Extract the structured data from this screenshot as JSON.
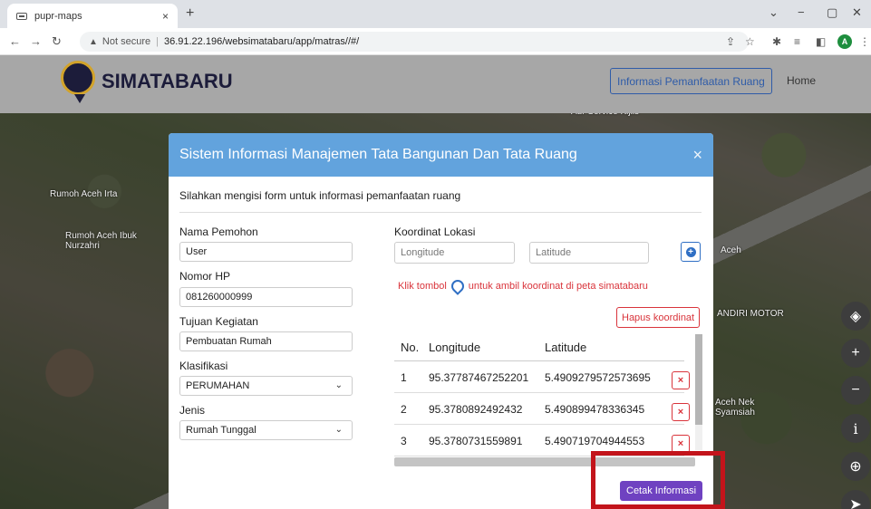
{
  "browser": {
    "tab_title": "pupr-maps",
    "tab_close": "×",
    "new_tab": "+",
    "security_text": "Not secure",
    "url": "36.91.22.196/websimatabaru/app/matras//#/",
    "profile_initial": "A"
  },
  "navbar": {
    "brand": "SIMATABARU",
    "info_button": "Informasi Pemanfaatan Ruang",
    "home_link": "Home"
  },
  "map_labels": [
    "Rumoh Aceh Irta",
    "Rumoh Aceh Ibuk Nurzahri",
    "Aceh",
    "ANDIRI MOTOR",
    "Aceh Nek Syamsiah",
    "Aur Service Kijils"
  ],
  "map_controls": [
    {
      "name": "layers-icon",
      "glyph": "◈"
    },
    {
      "name": "zoom-in-icon",
      "glyph": "+"
    },
    {
      "name": "zoom-out-icon",
      "glyph": "−"
    },
    {
      "name": "info-icon",
      "glyph": "i"
    },
    {
      "name": "globe-icon",
      "glyph": "⊕"
    }
  ],
  "modal": {
    "title": "Sistem Informasi Manajemen Tata Bangunan Dan Tata Ruang",
    "close": "×",
    "intro": "Silahkan mengisi form untuk informasi pemanfaatan ruang",
    "fields": {
      "nama_label": "Nama Pemohon",
      "nama_value": "User",
      "hp_label": "Nomor HP",
      "hp_value": "081260000999",
      "tujuan_label": "Tujuan Kegiatan",
      "tujuan_value": "Pembuatan Rumah",
      "klasifikasi_label": "Klasifikasi",
      "klasifikasi_value": "PERUMAHAN",
      "jenis_label": "Jenis",
      "jenis_value": "Rumah Tunggal"
    },
    "koordinat": {
      "label": "Koordinat Lokasi",
      "longitude_placeholder": "Longitude",
      "latitude_placeholder": "Latitude",
      "hint_prefix": "Klik tombol",
      "hint_suffix": "untuk ambil koordinat di peta simatabaru",
      "hapus_button": "Hapus koordinat"
    },
    "table": {
      "headers": {
        "no": "No.",
        "longitude": "Longitude",
        "latitude": "Latitude"
      },
      "rows": [
        {
          "no": "1",
          "longitude": "95.37787467252201",
          "latitude": "5.4909279572573695"
        },
        {
          "no": "2",
          "longitude": "95.3780892492432",
          "latitude": "5.490899478336345"
        },
        {
          "no": "3",
          "longitude": "95.3780731559891",
          "latitude": "5.490719704944553"
        }
      ],
      "delete_glyph": "×"
    },
    "cetak_button": "Cetak Informasi"
  }
}
